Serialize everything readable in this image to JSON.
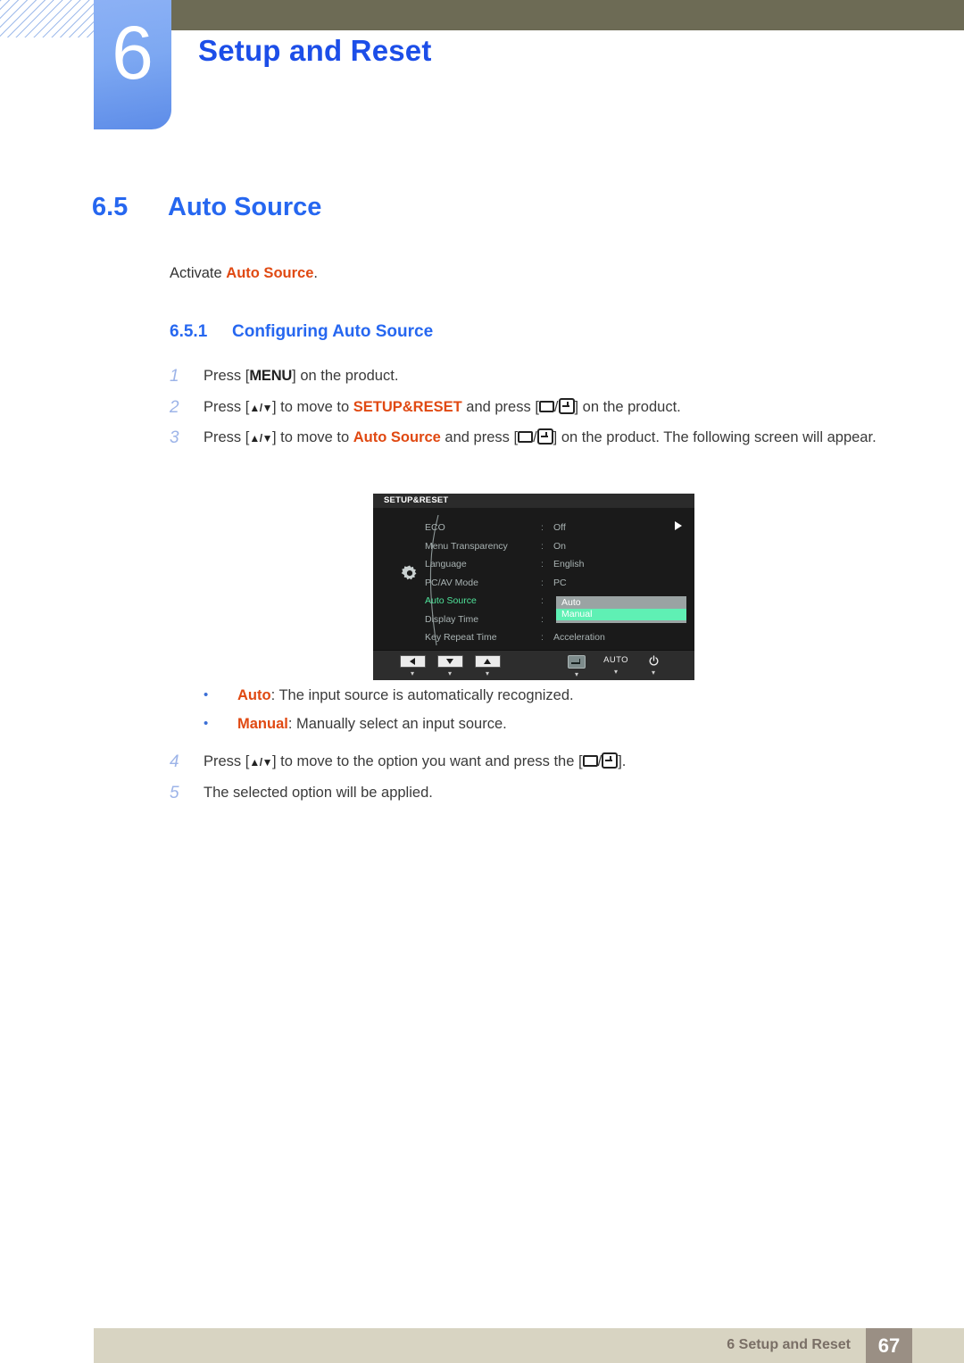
{
  "chapter": {
    "number": "6",
    "title": "Setup and Reset"
  },
  "section": {
    "number": "6.5",
    "title": "Auto Source"
  },
  "intro": {
    "before": "Activate ",
    "highlight": "Auto Source",
    "after": "."
  },
  "subsection": {
    "number": "6.5.1",
    "title": "Configuring Auto Source"
  },
  "steps": [
    {
      "n": "1",
      "parts": [
        {
          "t": "Press ["
        },
        {
          "t": "MENU",
          "style": "kbd"
        },
        {
          "t": "] on the product."
        }
      ]
    },
    {
      "n": "2",
      "parts": [
        {
          "t": "Press ["
        },
        {
          "t": "▲/▼",
          "style": "arrow"
        },
        {
          "t": "] to move to "
        },
        {
          "t": "SETUP&RESET",
          "style": "hl"
        },
        {
          "t": " and press ["
        },
        {
          "t": "icon-box",
          "style": "icon"
        },
        {
          "t": "/"
        },
        {
          "t": "icon-enter",
          "style": "icon"
        },
        {
          "t": "] on the product."
        }
      ]
    },
    {
      "n": "3",
      "parts": [
        {
          "t": "Press ["
        },
        {
          "t": "▲/▼",
          "style": "arrow"
        },
        {
          "t": "] to move to "
        },
        {
          "t": "Auto Source",
          "style": "hl"
        },
        {
          "t": " and press ["
        },
        {
          "t": "icon-box",
          "style": "icon"
        },
        {
          "t": "/"
        },
        {
          "t": "icon-enter",
          "style": "icon"
        },
        {
          "t": "] on the product. The following screen will appear."
        }
      ]
    }
  ],
  "bullets": [
    {
      "label": "Auto",
      "text": ": The input source is automatically recognized."
    },
    {
      "label": "Manual",
      "text": ": Manually select an input source."
    }
  ],
  "steps2": [
    {
      "n": "4",
      "parts": [
        {
          "t": "Press ["
        },
        {
          "t": "▲/▼",
          "style": "arrow"
        },
        {
          "t": "] to move to the option you want and press the ["
        },
        {
          "t": "icon-box",
          "style": "icon"
        },
        {
          "t": "/"
        },
        {
          "t": "icon-enter",
          "style": "icon"
        },
        {
          "t": "]."
        }
      ]
    },
    {
      "n": "5",
      "parts": [
        {
          "t": "The selected option will be applied."
        }
      ]
    }
  ],
  "osd": {
    "title": "SETUP&RESET",
    "rows": [
      {
        "label": "ECO",
        "colon": ":",
        "value": "Off",
        "active": false
      },
      {
        "label": "Menu Transparency",
        "colon": ":",
        "value": "On",
        "active": false
      },
      {
        "label": "Language",
        "colon": ":",
        "value": "English",
        "active": false
      },
      {
        "label": "PC/AV Mode",
        "colon": ":",
        "value": "PC",
        "active": false
      },
      {
        "label": "Auto Source",
        "colon": ":",
        "value": "",
        "active": true
      },
      {
        "label": "Display Time",
        "colon": ":",
        "value": "",
        "active": false
      },
      {
        "label": "Key Repeat Time",
        "colon": ":",
        "value": "Acceleration",
        "active": false
      }
    ],
    "dropdown": {
      "items": [
        {
          "label": "Auto",
          "selected": false
        },
        {
          "label": "Manual",
          "selected": true
        }
      ]
    },
    "footer_buttons": [
      {
        "kind": "left-arrow",
        "label": ""
      },
      {
        "kind": "down-arrow",
        "label": ""
      },
      {
        "kind": "up-arrow",
        "label": ""
      },
      {
        "kind": "enter",
        "label": ""
      },
      {
        "kind": "text",
        "label": "AUTO"
      },
      {
        "kind": "power",
        "label": ""
      }
    ],
    "colors": {
      "background": "#1a1a1a",
      "active_label": "#4fe39a",
      "dropdown_bg": "#9aa3a3",
      "dropdown_selected": "#5ff0b4"
    }
  },
  "footer": {
    "text": "6 Setup and Reset",
    "page": "67"
  },
  "colors": {
    "heading_blue": "#2667f0",
    "highlight_orange": "#e04912",
    "band_olive": "#6d6b55",
    "footer_band": "#d8d4c2",
    "footer_page_box": "#9a8f84"
  }
}
